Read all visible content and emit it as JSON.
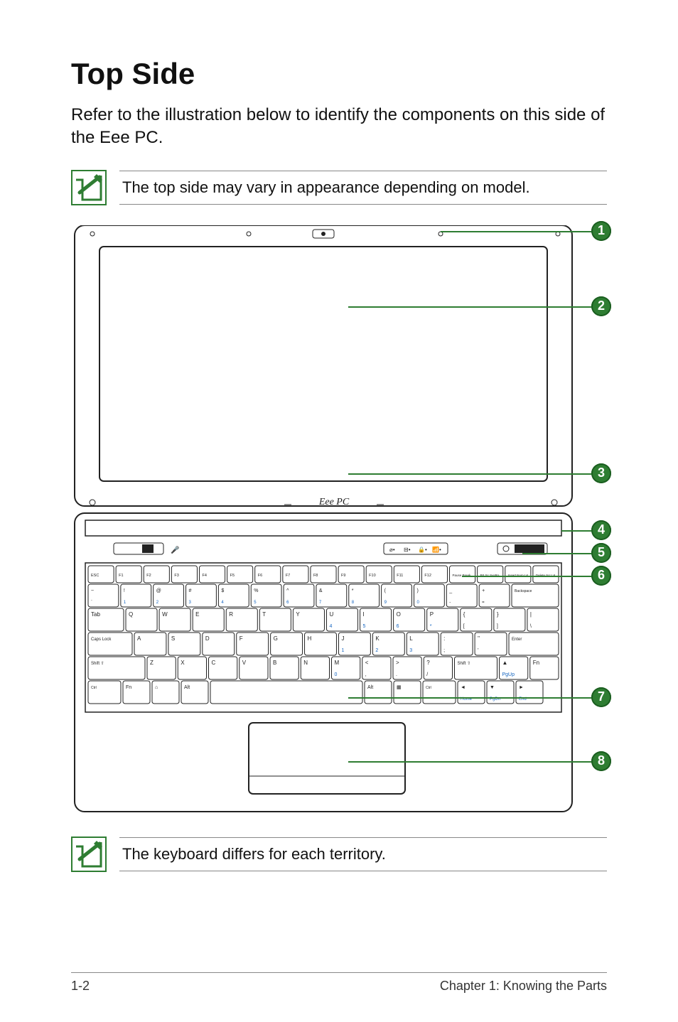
{
  "page": {
    "title": "Top Side",
    "intro": "Refer to the illustration below to identify the components on this side of the Eee PC.",
    "note1": "The top side may vary in appearance depending on model.",
    "note2": "The keyboard differs for each territory.",
    "logo": "Eee PC",
    "footer_left": "1-2",
    "footer_right": "Chapter 1: Knowing the Parts"
  },
  "callouts": [
    {
      "n": "1"
    },
    {
      "n": "2"
    },
    {
      "n": "3"
    },
    {
      "n": "4"
    },
    {
      "n": "5"
    },
    {
      "n": "6"
    },
    {
      "n": "7"
    },
    {
      "n": "8"
    }
  ],
  "keyboard_rows": {
    "function": [
      "ESC",
      "F1",
      "F2",
      "F3",
      "F4",
      "F5",
      "F6",
      "F7",
      "F8",
      "F9",
      "F10",
      "F11",
      "F12",
      "Pause Break",
      "Prt Sc SysRq",
      "Insert Num LK",
      "Delete Scr LK"
    ],
    "numbers_top": [
      "~",
      "!",
      "@",
      "#",
      "$",
      "%",
      "^",
      "&",
      "*",
      "(",
      ")",
      "_",
      "+",
      "Backspace"
    ],
    "numbers_bottom": [
      "`",
      "1",
      "2",
      "3",
      "4",
      "5",
      "6",
      "7",
      "8",
      "9",
      "0",
      "-",
      "=",
      ""
    ],
    "qwerty": [
      "Tab",
      "Q",
      "W",
      "E",
      "R",
      "T",
      "Y",
      "U",
      "I",
      "O",
      "P",
      "{",
      "}",
      "|"
    ],
    "qwerty_sub": [
      "",
      "",
      "",
      "",
      "",
      "",
      "",
      "4",
      "5",
      "6",
      "*",
      "[",
      "]",
      "\\"
    ],
    "home": [
      "Caps Lock",
      "A",
      "S",
      "D",
      "F",
      "G",
      "H",
      "J",
      "K",
      "L",
      ":",
      "\"",
      "Enter"
    ],
    "home_sub": [
      "",
      "",
      "",
      "",
      "",
      "",
      "",
      "1",
      "2",
      "3",
      ";",
      "'",
      ""
    ],
    "zxcv": [
      "Shift ⇧",
      "Z",
      "X",
      "C",
      "V",
      "B",
      "N",
      "M",
      "<",
      ">",
      "?",
      "Shift ⇧",
      "▲",
      "Fn"
    ],
    "zxcv_sub": [
      "",
      "",
      "",
      "",
      "",
      "",
      "",
      "0",
      ",",
      ".",
      "/",
      "",
      "PgUp",
      ""
    ],
    "bottom": [
      "Ctrl",
      "Fn",
      "⌂",
      "Alt",
      "",
      "Alt",
      "▦",
      "Ctrl",
      "◄",
      "▼",
      "►"
    ],
    "bottom_sub": [
      "",
      "",
      "",
      "",
      "",
      "",
      "",
      "",
      "Home",
      "PgDn",
      "End"
    ]
  }
}
